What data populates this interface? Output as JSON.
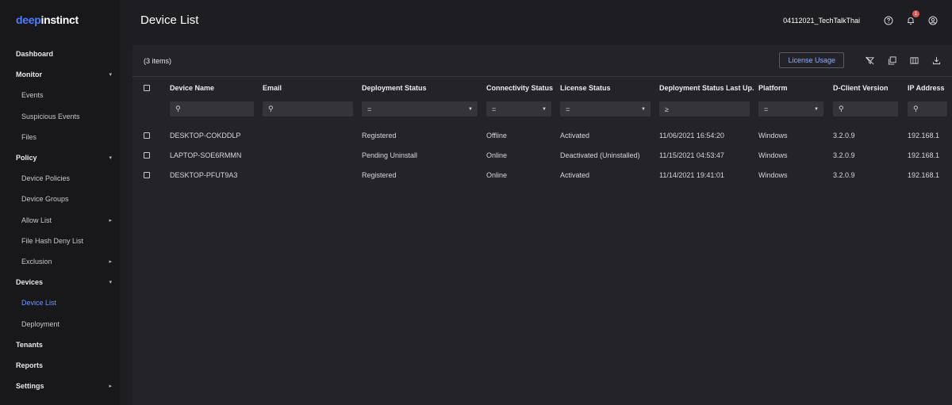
{
  "brand": {
    "part1": "deep",
    "part2": "instinct"
  },
  "page_title": "Device List",
  "header": {
    "tenant": "04112021_TechTalkThai",
    "notification_count": "1"
  },
  "sidebar": {
    "items": [
      {
        "label": "Dashboard",
        "type": "section",
        "chevron": ""
      },
      {
        "label": "Monitor",
        "type": "section",
        "chevron": "down"
      },
      {
        "label": "Events",
        "type": "sub",
        "chevron": ""
      },
      {
        "label": "Suspicious Events",
        "type": "sub",
        "chevron": ""
      },
      {
        "label": "Files",
        "type": "sub",
        "chevron": ""
      },
      {
        "label": "Policy",
        "type": "section",
        "chevron": "down"
      },
      {
        "label": "Device Policies",
        "type": "sub",
        "chevron": ""
      },
      {
        "label": "Device Groups",
        "type": "sub",
        "chevron": ""
      },
      {
        "label": "Allow List",
        "type": "sub",
        "chevron": "right"
      },
      {
        "label": "File Hash Deny List",
        "type": "sub",
        "chevron": ""
      },
      {
        "label": "Exclusion",
        "type": "sub",
        "chevron": "right"
      },
      {
        "label": "Devices",
        "type": "section",
        "chevron": "down"
      },
      {
        "label": "Device List",
        "type": "sub",
        "chevron": "",
        "active": true
      },
      {
        "label": "Deployment",
        "type": "sub",
        "chevron": ""
      },
      {
        "label": "Tenants",
        "type": "section",
        "chevron": ""
      },
      {
        "label": "Reports",
        "type": "section",
        "chevron": ""
      },
      {
        "label": "Settings",
        "type": "section",
        "chevron": "right"
      }
    ]
  },
  "panel": {
    "count": "(3 items)",
    "license_button": "License Usage"
  },
  "table": {
    "columns": [
      "Device Name",
      "Email",
      "Deployment Status",
      "Connectivity Status",
      "License Status",
      "Deployment Status Last Up...",
      "Platform",
      "D-Client Version",
      "IP Address"
    ],
    "filters": [
      {
        "icon": "⚲",
        "dropdown": false
      },
      {
        "icon": "⚲",
        "dropdown": false
      },
      {
        "icon": "=",
        "dropdown": true
      },
      {
        "icon": "=",
        "dropdown": true
      },
      {
        "icon": "=",
        "dropdown": true
      },
      {
        "icon": "≥",
        "dropdown": false
      },
      {
        "icon": "=",
        "dropdown": true
      },
      {
        "icon": "⚲",
        "dropdown": false
      },
      {
        "icon": "⚲",
        "dropdown": false
      }
    ],
    "rows": [
      [
        "DESKTOP-COKDDLP",
        "",
        "Registered",
        "Offline",
        "Activated",
        "11/06/2021 16:54:20",
        "Windows",
        "3.2.0.9",
        "192.168.1"
      ],
      [
        "LAPTOP-SOE6RMMN",
        "",
        "Pending Uninstall",
        "Online",
        "Deactivated (Uninstalled)",
        "11/15/2021 04:53:47",
        "Windows",
        "3.2.0.9",
        "192.168.1"
      ],
      [
        "DESKTOP-PFUT9A3",
        "",
        "Registered",
        "Online",
        "Activated",
        "11/14/2021 19:41:01",
        "Windows",
        "3.2.0.9",
        "192.168.1"
      ]
    ]
  }
}
